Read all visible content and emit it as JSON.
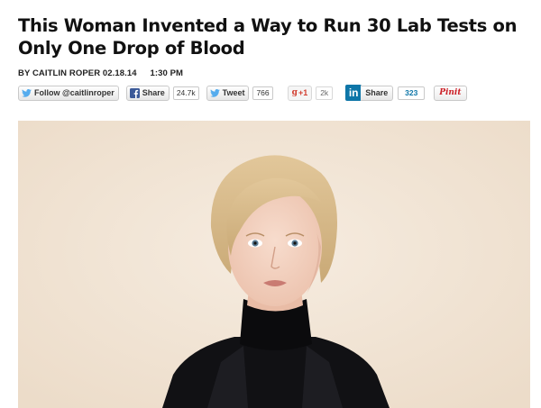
{
  "article": {
    "headline": "This Woman Invented a Way to Run 30 Lab Tests on Only One Drop of Blood",
    "byline": "BY CAITLIN ROPER",
    "date": "02.18.14",
    "time": "1:30 PM"
  },
  "share": {
    "twitter_follow_label": "Follow @caitlinroper",
    "facebook_label": "Share",
    "facebook_count": "24.7k",
    "tweet_label": "Tweet",
    "tweet_count": "766",
    "gplus_label": "+1",
    "gplus_count": "2k",
    "linkedin_logo": "in",
    "linkedin_label": "Share",
    "linkedin_count": "323",
    "pinterest_label": "Pinit"
  },
  "colors": {
    "twitter": "#55acee",
    "facebook": "#3b5998",
    "linkedin": "#0e76a8",
    "pinterest": "#cb2027",
    "gplus": "#d23f31",
    "photo_background": "#f1e5d6"
  },
  "icons": [
    "twitter-bird-icon",
    "facebook-icon",
    "linkedin-icon",
    "pinterest-icon",
    "google-plus-icon"
  ]
}
